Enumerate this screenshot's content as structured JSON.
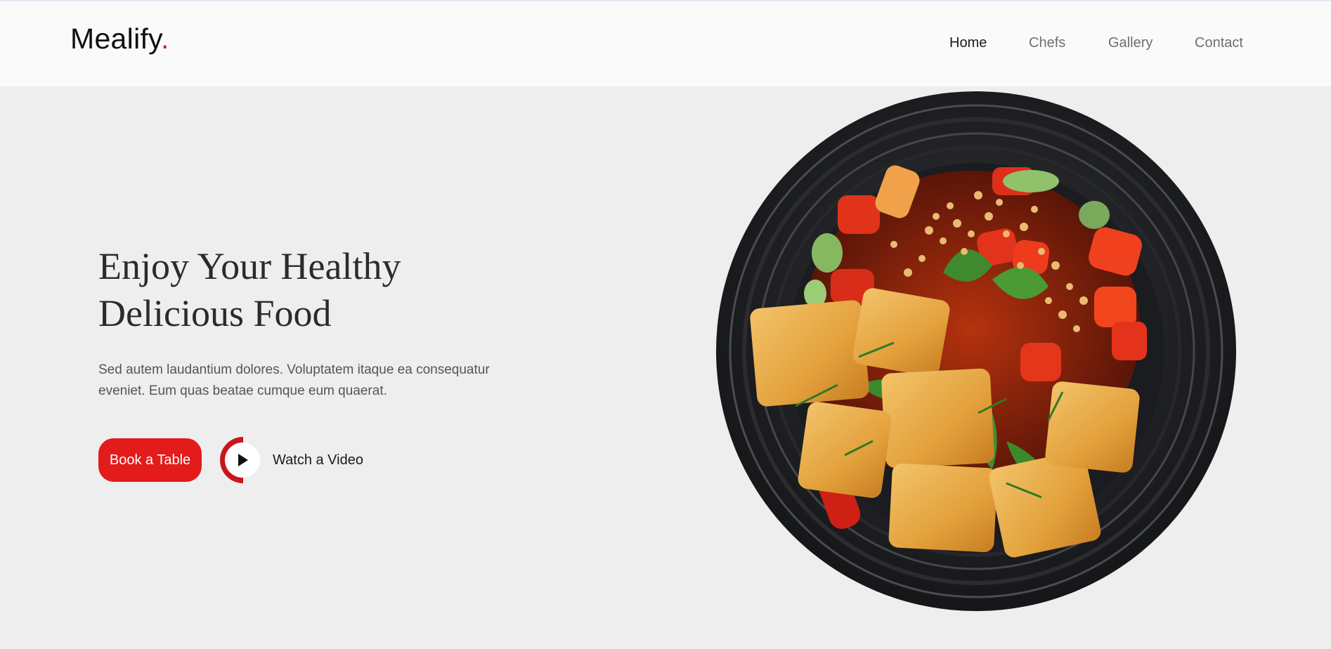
{
  "brand": {
    "name": "Mealify",
    "dot": ".",
    "accent_color": "#e31b1b"
  },
  "nav": {
    "items": [
      {
        "label": "Home",
        "active": true
      },
      {
        "label": "Chefs",
        "active": false
      },
      {
        "label": "Gallery",
        "active": false
      },
      {
        "label": "Contact",
        "active": false
      }
    ]
  },
  "hero": {
    "title_line1": "Enjoy Your Healthy",
    "title_line2": "Delicious Food",
    "subtitle_line1": "Sed autem laudantium dolores. Voluptatem itaque ea consequatur",
    "subtitle_line2": "eveniet. Eum quas beatae cumque eum quaerat.",
    "book_label": "Book a Table",
    "watch_label": "Watch a Video",
    "play_icon": "play-icon",
    "image": "food-dish-image"
  }
}
